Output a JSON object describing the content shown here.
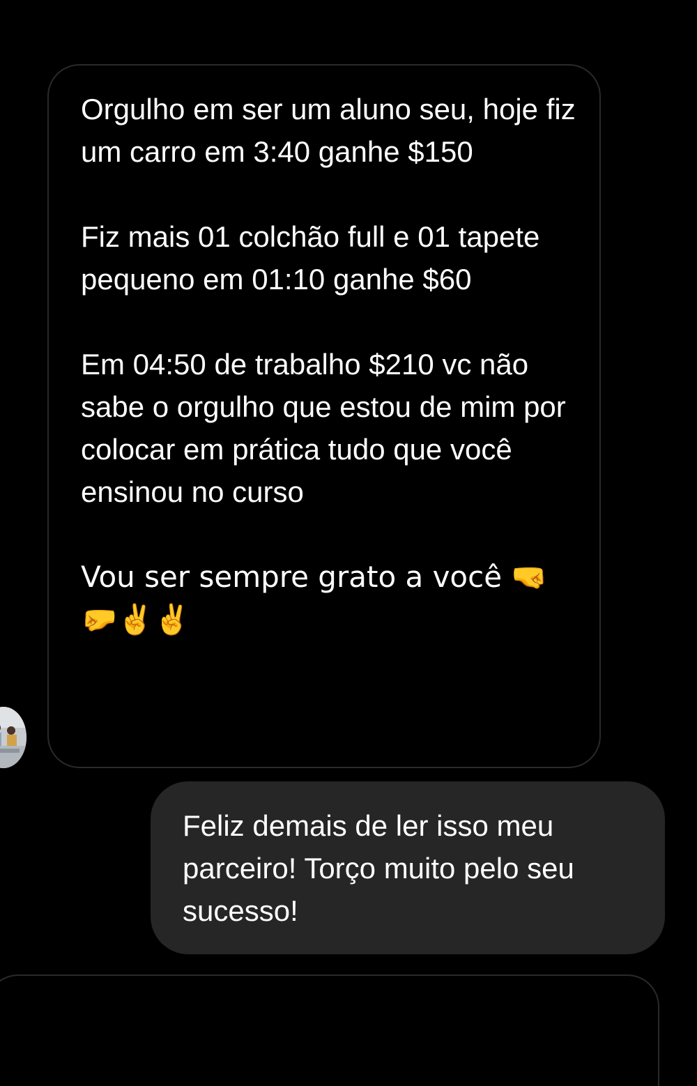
{
  "thread": {
    "received_message": {
      "paragraphs": [
        "Orgulho em ser um aluno seu, hoje fiz um carro em 3:40 ganhe $150",
        "Fiz mais 01 colchão full e 01 tapete pequeno em 01:10 ganhe $60",
        "Em 04:50 de trabalho $210 vc não sabe o orgulho que estou de mim por colocar em prática tudo que você ensinou no curso",
        "Vou ser sempre grato a você 🤜🤛✌️✌️"
      ]
    },
    "sent_message": {
      "text": "Feliz demais de ler isso meu parceiro! Torço muito pelo seu sucesso!"
    },
    "sender_avatar": {
      "icon": "profile-photo-avatar"
    }
  },
  "colors": {
    "background": "#000000",
    "received_bubble_border": "#2a2a2a",
    "sent_bubble_fill": "#262626",
    "text": "#ffffff"
  }
}
